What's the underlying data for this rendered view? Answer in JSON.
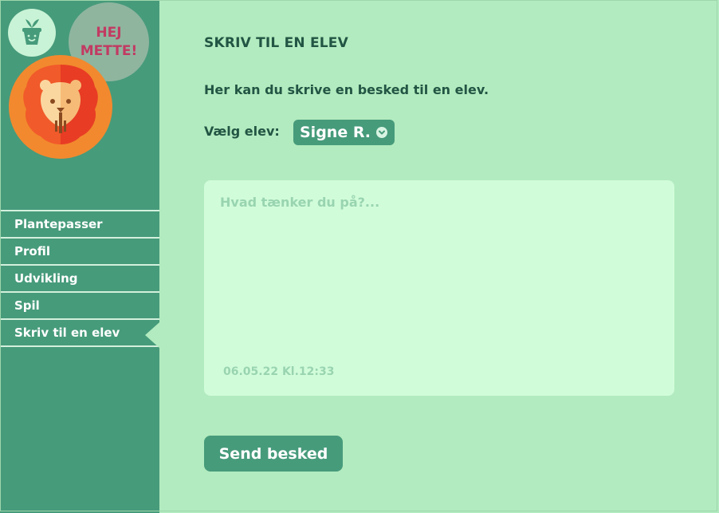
{
  "sidebar": {
    "greeting": "HEJ\nMETTE!",
    "app_icon": "plant-pot-icon",
    "avatar": "lion-avatar",
    "nav": [
      {
        "label": "Plantepasser",
        "active": false
      },
      {
        "label": "Profil",
        "active": false
      },
      {
        "label": "Udvikling",
        "active": false
      },
      {
        "label": "Spil",
        "active": false
      },
      {
        "label": "Skriv til en elev",
        "active": true
      }
    ]
  },
  "main": {
    "title": "SKRIV TIL EN ELEV",
    "intro": "Her kan du skrive en besked til en elev.",
    "select_label": "Vælg elev:",
    "selected_student": "Signe R.",
    "message": {
      "placeholder": "Hvad tænker du på?...",
      "value": "",
      "timestamp": "06.05.22 Kl.12:33"
    },
    "send_label": "Send besked"
  },
  "colors": {
    "background": "#b2ebbf",
    "sidebar": "#469b7b",
    "greeting_text": "#c23a62",
    "text_dark": "#235544",
    "message_box": "#d1fcda",
    "lion_orange": "#f2892e",
    "lion_red": "#e83c24"
  }
}
